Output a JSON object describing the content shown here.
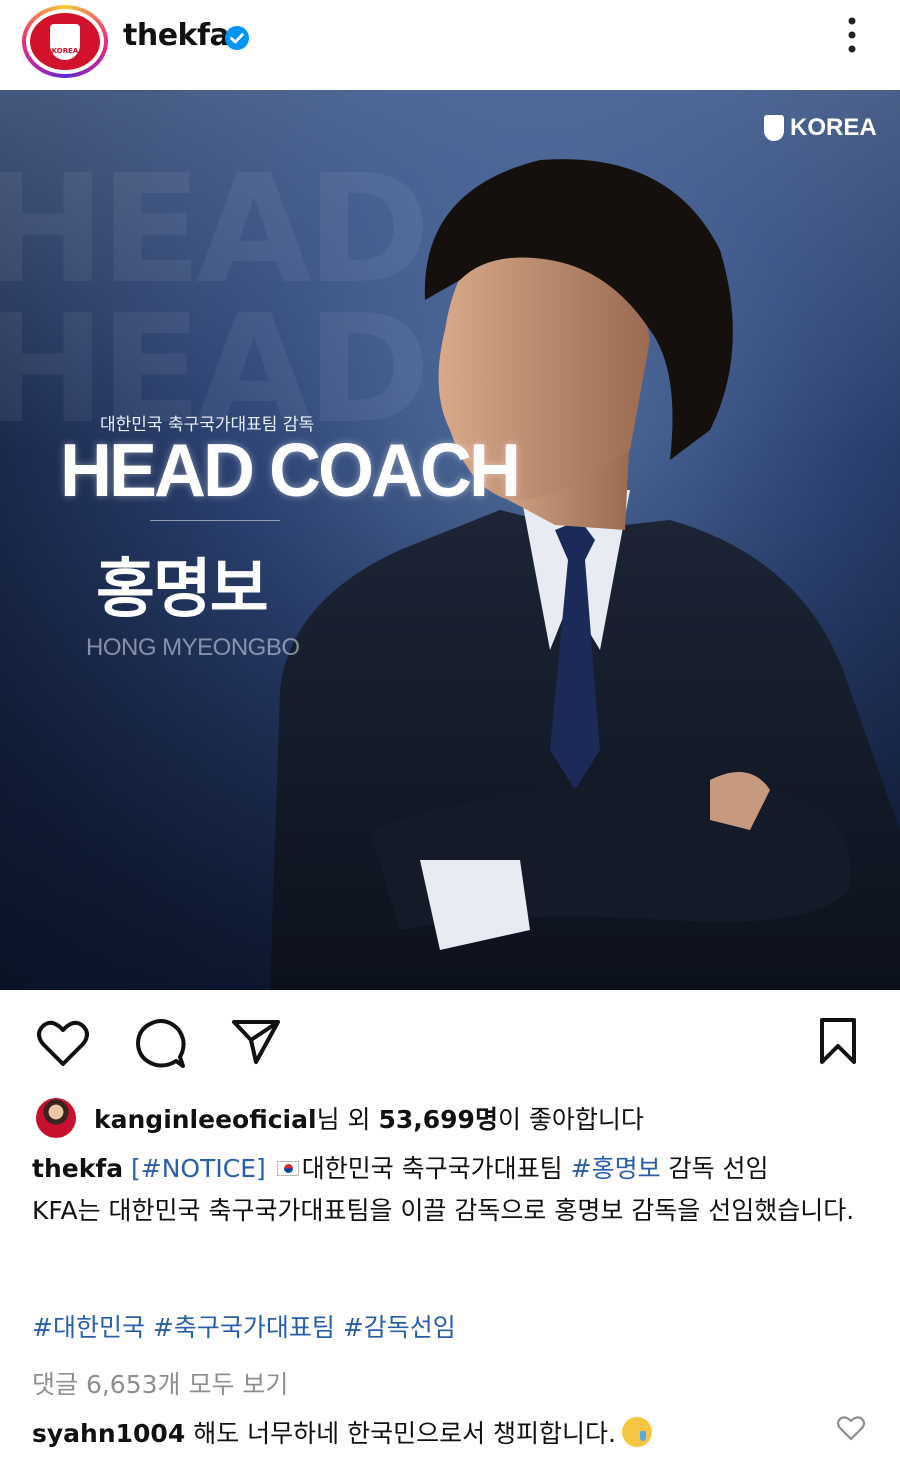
{
  "header": {
    "username": "thekfa",
    "avatar_text": "KOREA",
    "icons": {
      "verified": "verified-badge-icon",
      "more": "more-options-icon"
    }
  },
  "post_image": {
    "brand": "KOREA",
    "background_text": "HEAD HEAD",
    "subtitle": "대한민국 축구국가대표팀 감독",
    "headline": "HEAD COACH",
    "name_korean": "홍명보",
    "name_roman": "HONG MYEONGBO"
  },
  "actions": {
    "icons": [
      "heart-icon",
      "comment-icon",
      "share-icon",
      "bookmark-icon"
    ]
  },
  "likes": {
    "liker": "kanginleeoficial",
    "middle": "님 외 ",
    "count": "53,699명",
    "suffix": "이 좋아합니다"
  },
  "caption": {
    "user": "thekfa",
    "tag_notice": "[#NOTICE]",
    "line1_text": "대한민국 축구국가대표팀 ",
    "tag_name": "#홍명보",
    "line1_end": " 감독 선임",
    "body": "KFA는 대한민국 축구국가대표팀을 이끌 감독으로 홍명보 감독을 선임했습니다."
  },
  "hashtags": [
    "#대한민국",
    "#축구국가대표팀",
    "#감독선임"
  ],
  "view_comments": "댓글 6,653개 모두 보기",
  "comment": {
    "user": "syahn1004",
    "text": "해도 너무하네 한국민으로서 챙피합니다."
  },
  "colors": {
    "link": "#2a5fa8",
    "muted": "#8e8e8e",
    "brand_red": "#d0122a",
    "verified_blue": "#0095f6"
  }
}
